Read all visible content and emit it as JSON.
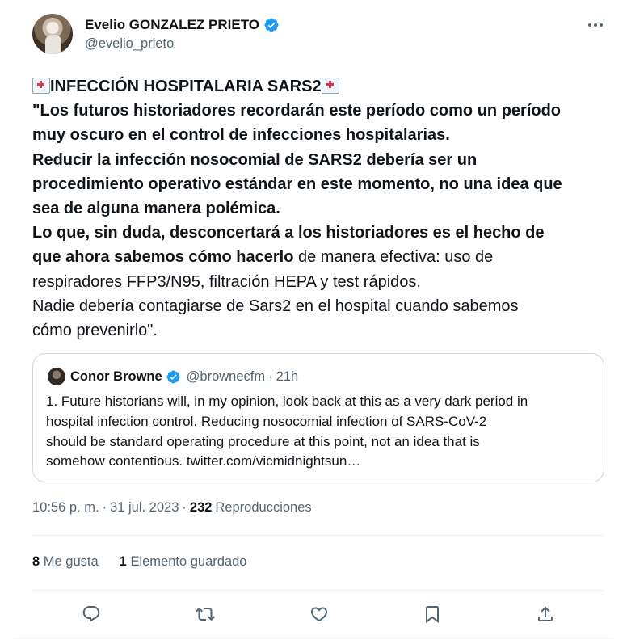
{
  "author": {
    "display_name": "Evelio GONZALEZ PRIETO",
    "handle": "@evelio_prieto",
    "verified_icon": "verified-badge-icon",
    "verified_color": "#1d9bf0"
  },
  "tweet": {
    "lines": [
      {
        "parts": [
          {
            "t": "INFECCIÓN HOSPITALARIA SARS2",
            "bold": true
          }
        ],
        "hospital_icons": true
      },
      {
        "parts": [
          {
            "t": "\"Los futuros historiadores recordarán este período como un período",
            "bold": true
          }
        ]
      },
      {
        "parts": [
          {
            "t": "muy oscuro en el control de infecciones hospitalarias.",
            "bold": true
          }
        ]
      },
      {
        "parts": [
          {
            "t": "Reducir la infección nosocomial de SARS2 debería ser un",
            "bold": true
          }
        ]
      },
      {
        "parts": [
          {
            "t": "procedimiento operativo estándar en este momento, no una idea que",
            "bold": true
          }
        ]
      },
      {
        "parts": [
          {
            "t": "sea de alguna manera polémica.",
            "bold": true
          }
        ]
      },
      {
        "parts": [
          {
            "t": "Lo que, sin duda, desconcertará a los historiadores es el hecho de",
            "bold": true
          }
        ]
      },
      {
        "parts": [
          {
            "t": "que ahora sabemos cómo hacerlo",
            "bold": true
          },
          {
            "t": " de manera efectiva: uso de",
            "bold": false
          }
        ]
      },
      {
        "parts": [
          {
            "t": "respiradores FFP3/N95, filtración HEPA y test rápidos.",
            "bold": false
          }
        ]
      },
      {
        "parts": [
          {
            "t": "Nadie debería contagiarse de Sars2 en el hospital cuando sabemos",
            "bold": false
          }
        ]
      },
      {
        "parts": [
          {
            "t": "cómo prevenirlo\".",
            "bold": false
          }
        ]
      }
    ]
  },
  "quote": {
    "name": "Conor Browne",
    "handle": "@brownecfm",
    "separator": "·",
    "time": "21h",
    "lines": [
      "1. Future historians will, in my opinion, look back at this as a very dark period in",
      "hospital infection control. Reducing nosocomial infection of SARS-CoV-2",
      "should be standard operating procedure at this point, not an idea that is",
      "somehow contentious. twitter.com/vicmidnightsun…"
    ]
  },
  "meta": {
    "time": "10:56 p. m.",
    "separator": "·",
    "date": "31 jul. 2023",
    "separator2": "·",
    "views_count": "232",
    "views_label": "Reproducciones"
  },
  "stats": {
    "likes_count": "8",
    "likes_label": "Me gusta",
    "bookmarks_count": "1",
    "bookmarks_label": "Elemento guardado"
  },
  "actions": [
    {
      "name": "reply-icon"
    },
    {
      "name": "retweet-icon"
    },
    {
      "name": "like-icon"
    },
    {
      "name": "bookmark-icon"
    },
    {
      "name": "share-icon"
    }
  ],
  "colors": {
    "text": "#0f1419",
    "secondary": "#536471",
    "border": "#cfd9de",
    "divider": "#eff3f4",
    "accent": "#1d9bf0"
  }
}
